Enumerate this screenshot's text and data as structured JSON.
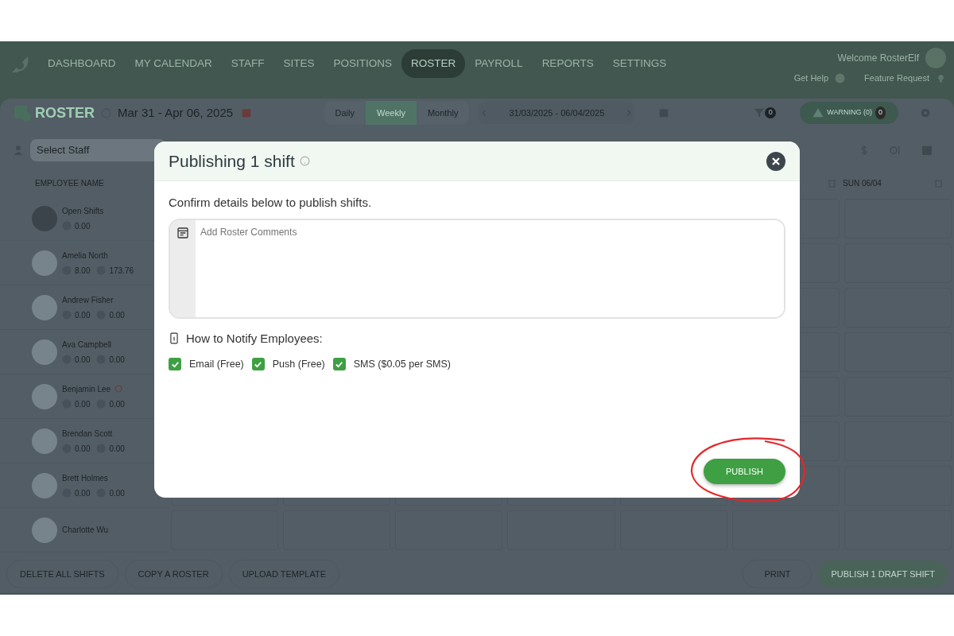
{
  "nav": {
    "items": [
      {
        "label": "DASHBOARD",
        "selected": false
      },
      {
        "label": "MY CALENDAR",
        "selected": false
      },
      {
        "label": "STAFF",
        "selected": false
      },
      {
        "label": "SITES",
        "selected": false
      },
      {
        "label": "POSITIONS",
        "selected": false
      },
      {
        "label": "ROSTER",
        "selected": true
      },
      {
        "label": "PAYROLL",
        "selected": false
      },
      {
        "label": "REPORTS",
        "selected": false
      },
      {
        "label": "SETTINGS",
        "selected": false
      }
    ],
    "welcome": "Welcome RosterElf",
    "get_help": "Get Help",
    "feature_request": "Feature Request"
  },
  "toolbar": {
    "title": "ROSTER",
    "date_range": "Mar 31 - Apr 06, 2025",
    "views": [
      {
        "label": "Daily",
        "selected": false
      },
      {
        "label": "Weekly",
        "selected": true
      },
      {
        "label": "Monthly",
        "selected": false
      }
    ],
    "range": "31/03/2025 - 06/04/2025",
    "filter_count": "0",
    "warning": "WARNING (0)",
    "warning_count": "0"
  },
  "staff_search": {
    "placeholder": "Select Staff"
  },
  "table": {
    "columns": [
      "EMPLOYEE NAME",
      "SUN 06/04"
    ],
    "rows": [
      {
        "kind": "open",
        "name": "Open Shifts",
        "hours": "0.00"
      },
      {
        "kind": "employee",
        "name": "Amelia North",
        "hours": "8.00",
        "pay": "173.76",
        "flag": false
      },
      {
        "kind": "employee",
        "name": "Andrew Fisher",
        "hours": "0.00",
        "pay": "0.00",
        "flag": false
      },
      {
        "kind": "employee",
        "name": "Ava Campbell",
        "hours": "0.00",
        "pay": "0.00",
        "flag": false
      },
      {
        "kind": "employee",
        "name": "Benjamin Lee",
        "hours": "0.00",
        "pay": "0.00",
        "flag": true
      },
      {
        "kind": "employee",
        "name": "Brendan Scott",
        "hours": "0.00",
        "pay": "0.00",
        "flag": false
      },
      {
        "kind": "employee",
        "name": "Brett Holmes",
        "hours": "0.00",
        "pay": "0.00",
        "flag": false
      },
      {
        "kind": "partial",
        "name": "Charlotte Wu"
      }
    ]
  },
  "footer": {
    "left": [
      "DELETE ALL SHIFTS",
      "COPY A ROSTER",
      "UPLOAD TEMPLATE"
    ],
    "print": "PRINT",
    "publish": "PUBLISH 1 DRAFT SHIFT"
  },
  "modal": {
    "title": "Publishing 1 shift",
    "subtitle": "Confirm details below to publish shifts.",
    "comments": {
      "placeholder": "Add Roster Comments"
    },
    "notify_label": "How to Notify Employees:",
    "options": [
      {
        "label": "Email (Free)",
        "checked": true
      },
      {
        "label": "Push (Free)",
        "checked": true
      },
      {
        "label": "SMS ($0.05 per SMS)",
        "checked": true
      }
    ],
    "publish": "PUBLISH"
  }
}
